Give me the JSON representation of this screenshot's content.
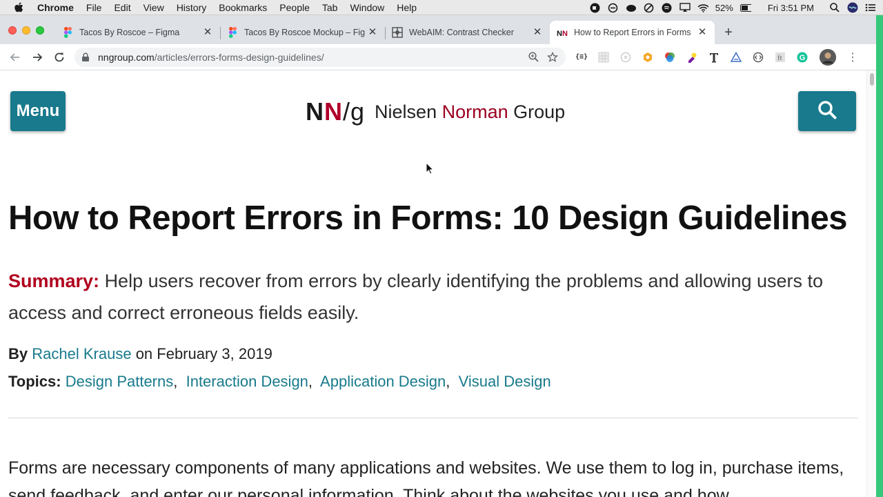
{
  "menubar": {
    "app": "Chrome",
    "items": [
      "File",
      "Edit",
      "View",
      "History",
      "Bookmarks",
      "People",
      "Tab",
      "Window",
      "Help"
    ],
    "battery": "52%",
    "clock": "Fri 3:51 PM"
  },
  "tabs": [
    {
      "title": "Tacos By Roscoe – Figma",
      "favicon": "figma-icon"
    },
    {
      "title": "Tacos By Roscoe Mockup – Fig",
      "favicon": "figma-icon"
    },
    {
      "title": "WebAIM: Contrast Checker",
      "favicon": "webaim-icon"
    },
    {
      "title": "How to Report Errors in Forms",
      "favicon": "nng-icon",
      "active": true
    }
  ],
  "omnibox": {
    "host": "nngroup.com",
    "path": "/articles/errors-forms-design-guidelines/"
  },
  "site": {
    "menu_label": "Menu",
    "logo_mark_n1": "N",
    "logo_mark_n2": "N",
    "logo_mark_slash": "/",
    "logo_mark_g": "g",
    "logo_name_1": "Nielsen",
    "logo_name_2": "Norman",
    "logo_name_3": "Group",
    "accent": "#187a8c",
    "brand_red": "#b0001e"
  },
  "article": {
    "title": "How to Report Errors in Forms: 10 Design Guidelines",
    "summary_label": "Summary:",
    "summary_text": "Help users recover from errors by clearly identifying the problems and allowing users to access and correct erroneous fields easily.",
    "by_label": "By",
    "author": "Rachel Krause",
    "date_text": "on February 3, 2019",
    "topics_label": "Topics:",
    "topics": [
      "Design Patterns",
      "Interaction Design",
      "Application Design",
      "Visual Design"
    ],
    "body": "Forms are necessary components of many applications and websites. We use them to log in, purchase items, send feedback, and enter our personal information. Think about the websites you use and how"
  }
}
